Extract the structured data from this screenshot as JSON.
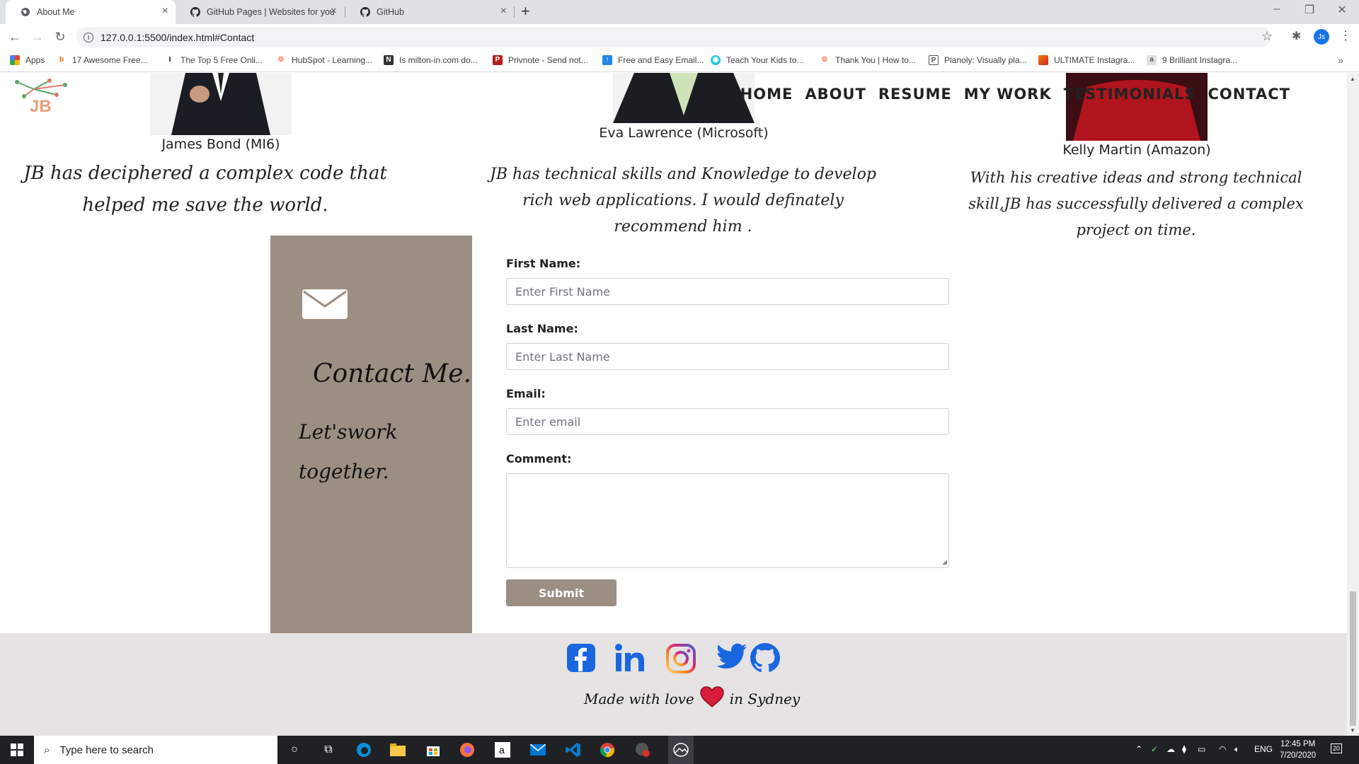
{
  "browser": {
    "tabs": [
      {
        "title": "About Me",
        "icon": "globe-icon"
      },
      {
        "title": "GitHub Pages | Websites for you",
        "icon": "github-icon"
      },
      {
        "title": "GitHub",
        "icon": "github-icon"
      }
    ],
    "url": "127.0.0.1:5500/index.html#Contact",
    "bookmarks": [
      "Apps",
      "17 Awesome Free...",
      "The Top 5 Free Onli...",
      "HubSpot - Learning...",
      "Is milton-in.com do...",
      "Privnote - Send not...",
      "Free and Easy Email...",
      "Teach Your Kids to...",
      "Thank You | How to...",
      "Planoly: Visually pla...",
      "ULTIMATE Instagra...",
      "9 Brilliant Instagra..."
    ],
    "profile_initials": "Js"
  },
  "site": {
    "logo_text": "JB",
    "nav": [
      "HOME",
      "ABOUT",
      "RESUME",
      "MY WORK",
      "TESTIMONIALS",
      "CONTACT"
    ],
    "testimonials": [
      {
        "name": "James Bond (MI6)",
        "quote": "JB has deciphered a complex code that helped me save the world."
      },
      {
        "name": "Eva Lawrence (Microsoft)",
        "quote": "JB has technical skills and Knowledge to develop rich web applications. I would definately recommend him ."
      },
      {
        "name": "Kelly Martin (Amazon)",
        "quote": "With his creative ideas and strong technical skill,JB has successfully delivered a complex project on time."
      }
    ],
    "contact": {
      "title": "Contact Me.",
      "subtitle": "Let'swork together.",
      "first_name_label": "First Name:",
      "first_name_placeholder": "Enter First Name",
      "last_name_label": "Last Name:",
      "last_name_placeholder": "Enter Last Name",
      "email_label": "Email:",
      "email_placeholder": "Enter email",
      "comment_label": "Comment:",
      "submit_label": "Submit"
    },
    "footer": {
      "socials": [
        "facebook-icon",
        "linkedin-icon",
        "instagram-icon",
        "twitter-icon",
        "github-icon"
      ],
      "made_with": "Made with love",
      "in_city": "in Sydney"
    },
    "colors": {
      "accent": "#9b8f84",
      "social_blue": "#1a66e0",
      "heart": "#d81e3c"
    }
  },
  "taskbar": {
    "search_placeholder": "Type here to search",
    "language": "ENG",
    "time": "12:45 PM",
    "date": "7/20/2020",
    "notification_count": "20"
  }
}
